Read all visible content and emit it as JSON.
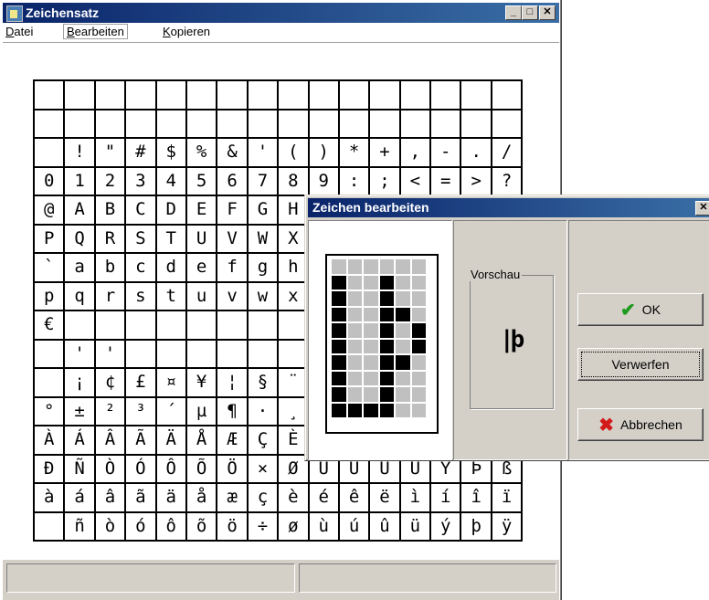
{
  "window": {
    "title": "Zeichensatz"
  },
  "menu": {
    "datei": {
      "lead": "D",
      "rest": "atei"
    },
    "bearbeiten": {
      "lead": "B",
      "rest": "earbeiten"
    },
    "kopieren": {
      "lead": "K",
      "rest": "opieren"
    }
  },
  "grid_rows": [
    [
      "",
      "",
      "",
      "",
      "",
      "",
      "",
      "",
      "",
      "",
      "",
      "",
      "",
      "",
      "",
      ""
    ],
    [
      "",
      "",
      "",
      "",
      "",
      "",
      "",
      "",
      "",
      "",
      "",
      "",
      "",
      "",
      "",
      ""
    ],
    [
      "",
      "!",
      "\"",
      "#",
      "$",
      "%",
      "&",
      "'",
      "(",
      ")",
      "*",
      "+",
      ",",
      "-",
      ".",
      "/"
    ],
    [
      "0",
      "1",
      "2",
      "3",
      "4",
      "5",
      "6",
      "7",
      "8",
      "9",
      ":",
      ";",
      "<",
      "=",
      ">",
      "?"
    ],
    [
      "@",
      "A",
      "B",
      "C",
      "D",
      "E",
      "F",
      "G",
      "H",
      "",
      "",
      "",
      "",
      "",
      "",
      ""
    ],
    [
      "P",
      "Q",
      "R",
      "S",
      "T",
      "U",
      "V",
      "W",
      "X",
      "",
      "",
      "",
      "",
      "",
      "",
      ""
    ],
    [
      "`",
      "a",
      "b",
      "c",
      "d",
      "e",
      "f",
      "g",
      "h",
      "",
      "",
      "",
      "",
      "",
      "",
      ""
    ],
    [
      "p",
      "q",
      "r",
      "s",
      "t",
      "u",
      "v",
      "w",
      "x",
      "",
      "",
      "",
      "",
      "",
      "",
      ""
    ],
    [
      "€",
      "",
      "",
      "",
      "",
      "",
      "",
      "",
      "",
      "",
      "",
      "",
      "",
      "",
      "",
      ""
    ],
    [
      "",
      "'",
      "'",
      "",
      "",
      "",
      "",
      "",
      "",
      "",
      "",
      "",
      "",
      "",
      "",
      ""
    ],
    [
      "",
      "¡",
      "¢",
      "£",
      "¤",
      "¥",
      "¦",
      "§",
      "¨",
      "",
      "",
      "",
      "",
      "",
      "",
      ""
    ],
    [
      "°",
      "±",
      "²",
      "³",
      "´",
      "µ",
      "¶",
      "·",
      "¸",
      "",
      "",
      "",
      "",
      "",
      "",
      ""
    ],
    [
      "À",
      "Á",
      "Â",
      "Ã",
      "Ä",
      "Å",
      "Æ",
      "Ç",
      "È",
      "",
      "",
      "",
      "",
      "",
      "",
      ""
    ],
    [
      "Ð",
      "Ñ",
      "Ò",
      "Ó",
      "Ô",
      "Õ",
      "Ö",
      "×",
      "Ø",
      "Ù",
      "Ú",
      "Û",
      "Ü",
      "Ý",
      "Þ",
      "ß"
    ],
    [
      "à",
      "á",
      "â",
      "ã",
      "ä",
      "å",
      "æ",
      "ç",
      "è",
      "é",
      "ê",
      "ë",
      "ì",
      "í",
      "î",
      "ï"
    ],
    [
      "",
      "ñ",
      "ò",
      "ó",
      "ô",
      "õ",
      "ö",
      "÷",
      "ø",
      "ù",
      "ú",
      "û",
      "ü",
      "ý",
      "þ",
      "ÿ"
    ]
  ],
  "dialog": {
    "title": "Zeichen bearbeiten",
    "preview_label": "Vorschau",
    "preview_glyph": "|þ",
    "ok_label": "OK",
    "discard_label": "Verwerfen",
    "cancel_label": "Abbrechen"
  },
  "pixel_bitmap": [
    [
      0,
      0,
      0,
      0,
      0,
      0
    ],
    [
      1,
      0,
      0,
      1,
      0,
      0
    ],
    [
      1,
      0,
      0,
      1,
      0,
      0
    ],
    [
      1,
      0,
      0,
      1,
      1,
      0
    ],
    [
      1,
      0,
      0,
      1,
      0,
      1
    ],
    [
      1,
      0,
      0,
      1,
      0,
      1
    ],
    [
      1,
      0,
      0,
      1,
      1,
      0
    ],
    [
      1,
      0,
      0,
      1,
      0,
      0
    ],
    [
      1,
      0,
      0,
      1,
      0,
      0
    ],
    [
      1,
      1,
      1,
      1,
      0,
      0
    ]
  ],
  "icons": {
    "app": "charmap-app-icon",
    "ok": "check-icon",
    "cancel": "cross-icon",
    "minimize": "minimize-icon",
    "maximize": "maximize-icon",
    "close": "close-icon"
  }
}
